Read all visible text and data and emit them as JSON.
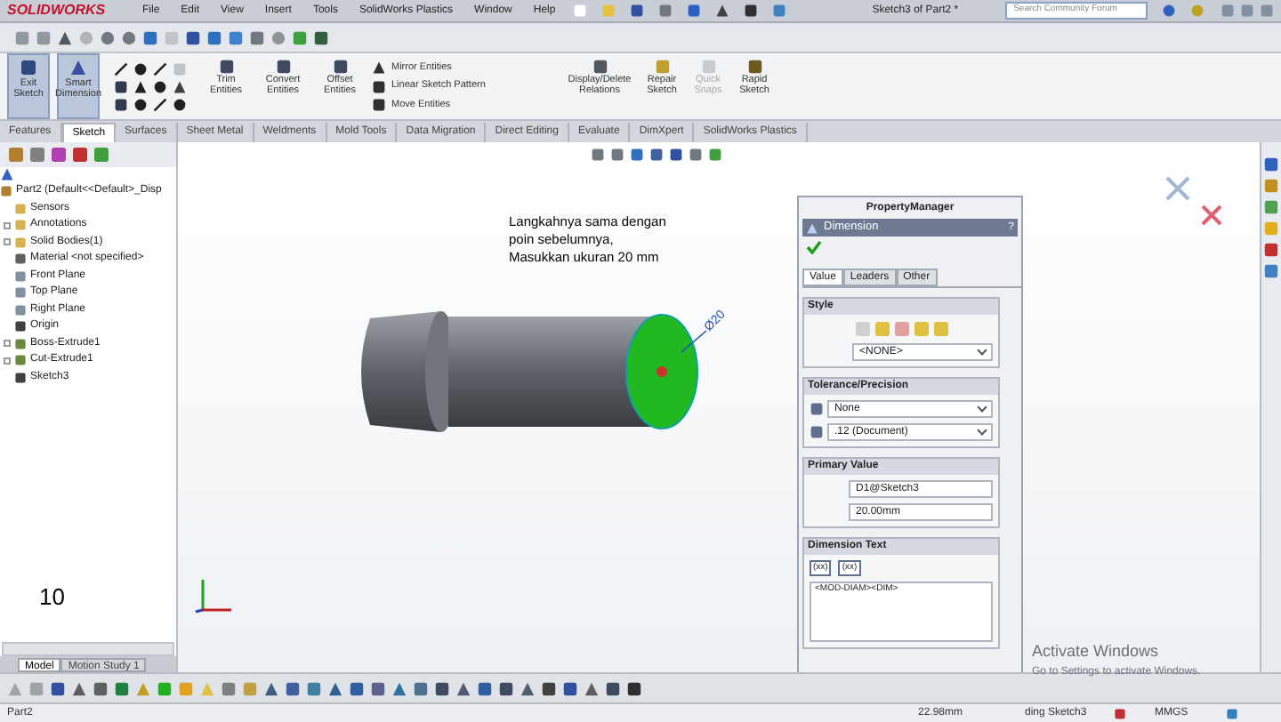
{
  "app": {
    "logo": "SOLIDWORKS",
    "menu": [
      "File",
      "Edit",
      "View",
      "Insert",
      "Tools",
      "SolidWorks Plastics",
      "Window",
      "Help"
    ],
    "document_title": "Sketch3 of Part2 *",
    "search": {
      "placeholder": "Search Community Forum"
    }
  },
  "command_manager": {
    "large_buttons": [
      {
        "label": "Exit Sketch",
        "selected": true,
        "disabled": false
      },
      {
        "label": "Smart Dimension",
        "selected": true,
        "disabled": false
      }
    ],
    "tool_buttons": [
      {
        "label": "Trim Entities",
        "disabled": false
      },
      {
        "label": "Convert Entities",
        "disabled": false
      },
      {
        "label": "Offset Entities",
        "disabled": false
      }
    ],
    "small_buttons": [
      "Mirror Entities",
      "Linear Sketch Pattern",
      "Move Entities"
    ],
    "right_buttons": [
      {
        "label": "Display/Delete Relations",
        "disabled": false
      },
      {
        "label": "Repair Sketch",
        "disabled": false
      },
      {
        "label": "Quick Snaps",
        "disabled": true
      },
      {
        "label": "Rapid Sketch",
        "disabled": false
      }
    ]
  },
  "tabs": [
    {
      "label": "Features",
      "selected": false
    },
    {
      "label": "Sketch",
      "selected": true
    },
    {
      "label": "Surfaces",
      "selected": false
    },
    {
      "label": "Sheet Metal",
      "selected": false
    },
    {
      "label": "Weldments",
      "selected": false
    },
    {
      "label": "Mold Tools",
      "selected": false
    },
    {
      "label": "Data Migration",
      "selected": false
    },
    {
      "label": "Direct Editing",
      "selected": false
    },
    {
      "label": "Evaluate",
      "selected": false
    },
    {
      "label": "DimXpert",
      "selected": false
    },
    {
      "label": "SolidWorks Plastics",
      "selected": false
    }
  ],
  "feature_tree": {
    "root": "Part2  (Default<<Default>_Disp",
    "items": [
      {
        "label": "Sensors",
        "expandable": false,
        "color": "#d8b050"
      },
      {
        "label": "Annotations",
        "expandable": true,
        "color": "#d8b050"
      },
      {
        "label": "Solid Bodies(1)",
        "expandable": true,
        "color": "#d8b050"
      },
      {
        "label": "Material <not specified>",
        "expandable": false,
        "color": "#606060"
      },
      {
        "label": "Front Plane",
        "expandable": false,
        "color": "#8090a0"
      },
      {
        "label": "Top Plane",
        "expandable": false,
        "color": "#8090a0"
      },
      {
        "label": "Right Plane",
        "expandable": false,
        "color": "#8090a0"
      },
      {
        "label": "Origin",
        "expandable": false,
        "color": "#404040"
      },
      {
        "label": "Boss-Extrude1",
        "expandable": true,
        "color": "#6a8a3a"
      },
      {
        "label": "Cut-Extrude1",
        "expandable": true,
        "color": "#6a8a3a"
      },
      {
        "label": "Sketch3",
        "expandable": false,
        "color": "#404040"
      }
    ]
  },
  "step_number": "10",
  "annotation": [
    "Langkahnya sama dengan",
    "poin sebelumnya,",
    "Masukkan ukuran 20 mm"
  ],
  "dimension_label": "Ø20",
  "property_manager": {
    "header": "PropertyManager",
    "title": "Dimension",
    "help": "?",
    "tabs": [
      {
        "label": "Value",
        "selected": true
      },
      {
        "label": "Leaders",
        "selected": false
      },
      {
        "label": "Other",
        "selected": false
      }
    ],
    "style": {
      "title": "Style",
      "dropdown": "<NONE>"
    },
    "tolerance": {
      "title": "Tolerance/Precision",
      "dropdowns": [
        "None",
        ".12 (Document)"
      ]
    },
    "primary_value": {
      "title": "Primary Value",
      "fields": [
        "D1@Sketch3",
        "20.00mm"
      ]
    },
    "dimension_text": {
      "title": "Dimension Text",
      "buttons": [
        "(xx)",
        "(xx)"
      ],
      "text": "<MOD-DIAM><DIM>"
    }
  },
  "bottom_tabs": [
    {
      "label": "Model",
      "selected": true
    },
    {
      "label": "Motion Study 1",
      "selected": false
    }
  ],
  "windows_notice": [
    "Activate Windows",
    "Go to Settings to activate Windows."
  ],
  "status_bar": [
    "Part2",
    "22.98mm",
    "ding Sketch3",
    "MMGS"
  ]
}
